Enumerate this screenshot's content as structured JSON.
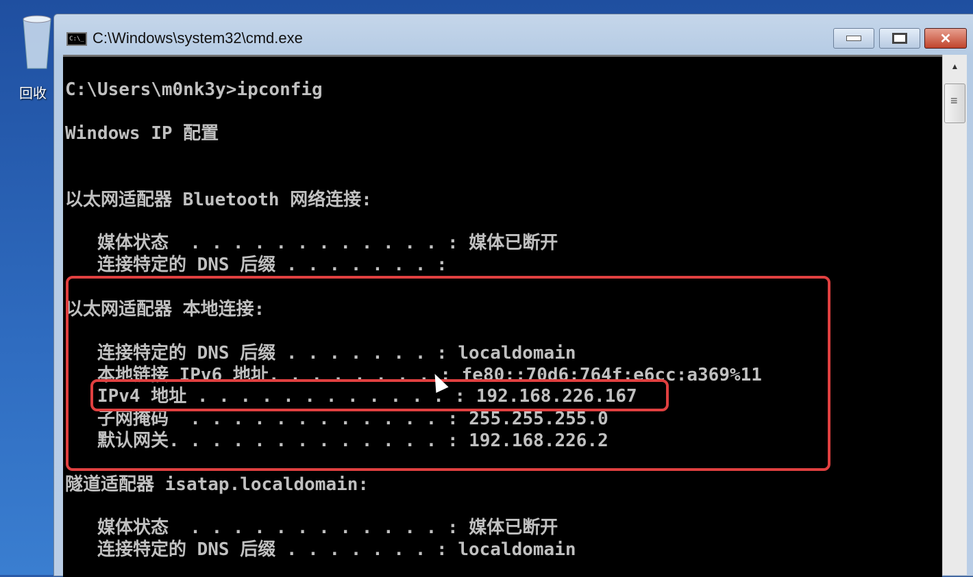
{
  "desktop": {
    "recycle_bin_label": "回收"
  },
  "window": {
    "title": "C:\\Windows\\system32\\cmd.exe",
    "icon_text": "C:\\_"
  },
  "console": {
    "lines": [
      "C:\\Users\\m0nk3y>ipconfig",
      "Windows IP 配置",
      "以太网适配器 Bluetooth 网络连接:",
      "   媒体状态  . . . . . . . . . . . . : 媒体已断开",
      "   连接特定的 DNS 后缀 . . . . . . . :",
      "以太网适配器 本地连接:",
      "   连接特定的 DNS 后缀 . . . . . . . : localdomain",
      "   本地链接 IPv6 地址. . . . . . . . : fe80::70d6:764f:e6cc:a369%11",
      "   IPv4 地址 . . . . . . . . . . . . : 192.168.226.167",
      "   子网掩码  . . . . . . . . . . . . : 255.255.255.0",
      "   默认网关. . . . . . . . . . . . . : 192.168.226.2",
      "隧道适配器 isatap.localdomain:",
      "   媒体状态  . . . . . . . . . . . . : 媒体已断开",
      "   连接特定的 DNS 后缀 . . . . . . . : localdomain"
    ]
  },
  "colors": {
    "highlight": "#e04040",
    "console_text": "#c0c0c0"
  }
}
